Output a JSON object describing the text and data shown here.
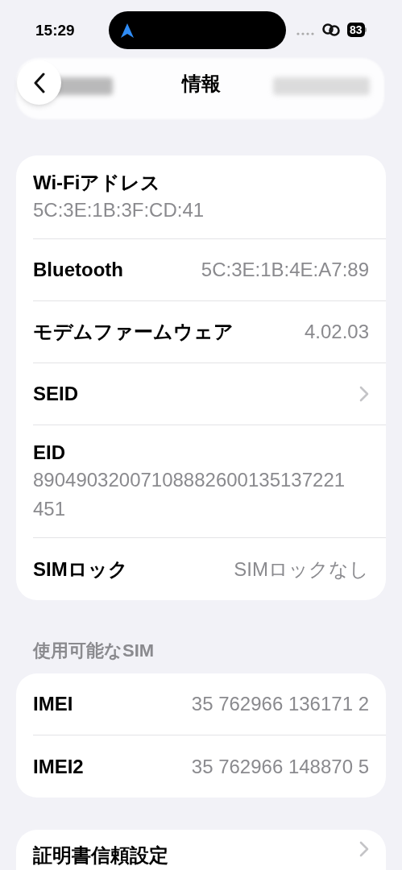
{
  "status_bar": {
    "time": "15:29",
    "battery": "83"
  },
  "nav": {
    "title": "情報"
  },
  "groups": [
    {
      "rows": [
        {
          "kind": "stacked",
          "label": "Wi-Fiアドレス",
          "value": "5C:3E:1B:3F:CD:41"
        },
        {
          "kind": "inline",
          "label": "Bluetooth",
          "value": "5C:3E:1B:4E:A7:89"
        },
        {
          "kind": "inline",
          "label": "モデムファームウェア",
          "value": "4.02.03"
        },
        {
          "kind": "link",
          "label": "SEID"
        },
        {
          "kind": "stacked",
          "label": "EID",
          "value": "89049032007108882600135137221451"
        },
        {
          "kind": "inline",
          "label": "SIMロック",
          "value": "SIMロックなし"
        }
      ]
    },
    {
      "header": "使用可能なSIM",
      "rows": [
        {
          "kind": "inline",
          "label": "IMEI",
          "value": "35 762966 136171 2"
        },
        {
          "kind": "inline",
          "label": "IMEI2",
          "value": "35 762966 148870 5"
        }
      ]
    },
    {
      "rows": [
        {
          "kind": "link",
          "label": "証明書信頼設定"
        }
      ]
    }
  ]
}
